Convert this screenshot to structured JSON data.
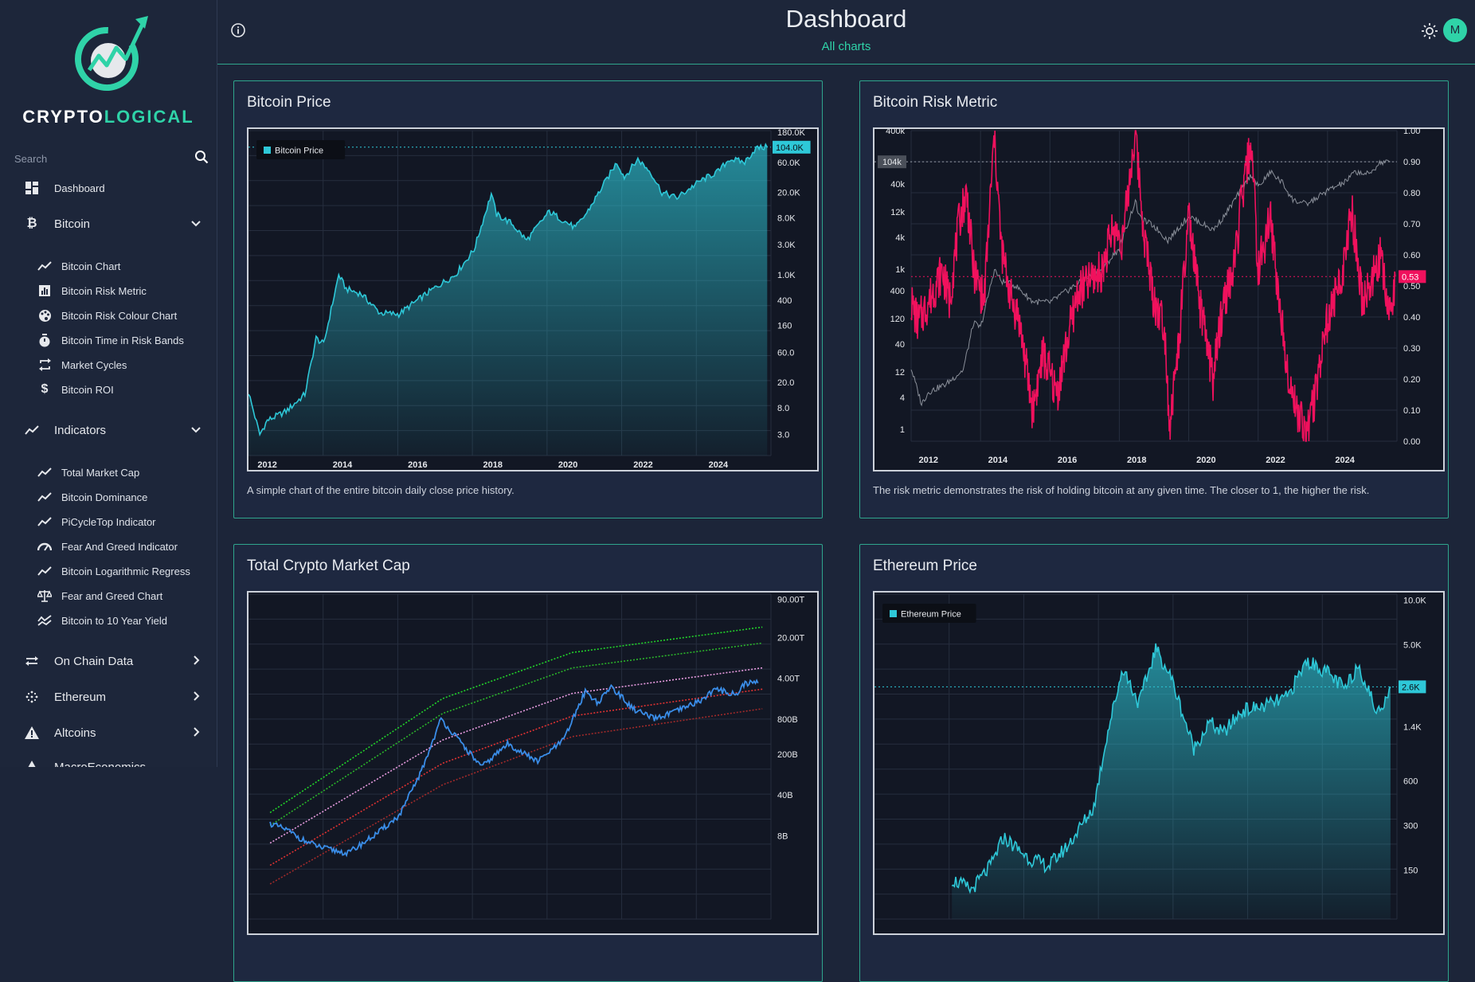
{
  "brand": {
    "name_prefix": "CRYPTO",
    "name_accent": "LOGICAL"
  },
  "search": {
    "placeholder": "Search"
  },
  "sidebar": {
    "dashboard": "Dashboard",
    "bitcoin": {
      "label": "Bitcoin",
      "items": [
        "Bitcoin Chart",
        "Bitcoin Risk Metric",
        "Bitcoin Risk Colour Chart",
        "Bitcoin Time in Risk Bands",
        "Market Cycles",
        "Bitcoin ROI"
      ]
    },
    "indicators": {
      "label": "Indicators",
      "items": [
        "Total Market Cap",
        "Bitcoin Dominance",
        "PiCycleTop Indicator",
        "Fear And Greed Indicator",
        "Bitcoin Logarithmic Regress",
        "Fear and Greed Chart",
        "Bitcoin to 10 Year Yield"
      ]
    },
    "on_chain": "On Chain Data",
    "ethereum": "Ethereum",
    "altcoins": "Altcoins",
    "macro": "MacroEconomics"
  },
  "header": {
    "title": "Dashboard",
    "subtitle": "All charts",
    "avatar_letter": "M"
  },
  "colors": {
    "accent": "#2fd3a8",
    "btc_line": "#2ec8d8",
    "risk_line": "#f0115d",
    "mcap_line": "#3a8de8"
  },
  "cards": {
    "btc_price": {
      "title": "Bitcoin Price",
      "desc": "A simple chart of the entire bitcoin daily close price history."
    },
    "btc_risk": {
      "title": "Bitcoin Risk Metric",
      "desc": "The risk metric demonstrates the risk of holding bitcoin at any given time. The closer to 1, the higher the risk."
    },
    "mcap": {
      "title": "Total Crypto Market Cap"
    },
    "eth_price": {
      "title": "Ethereum Price"
    }
  },
  "chart_data": [
    {
      "type": "area",
      "title": "Bitcoin Price",
      "scale": "log",
      "legend": "Bitcoin Price",
      "legend_position": "top-left",
      "x_ticks": [
        "2012",
        "2014",
        "2016",
        "2018",
        "2020",
        "2022",
        "2024"
      ],
      "y_ticks": [
        "180.0K",
        "60.0K",
        "20.0K",
        "8.0K",
        "3.0K",
        "1.0K",
        "400",
        "160",
        "60.0",
        "20.0",
        "8.0",
        "3.0"
      ],
      "last_value_label": "104.0K",
      "x": [
        2011.5,
        2011.8,
        2012.0,
        2012.5,
        2013.0,
        2013.3,
        2013.5,
        2013.9,
        2014.1,
        2014.5,
        2015.0,
        2015.5,
        2016.0,
        2016.5,
        2017.0,
        2017.5,
        2017.96,
        2018.1,
        2018.5,
        2018.9,
        2019.5,
        2020.2,
        2020.5,
        2021.0,
        2021.3,
        2021.5,
        2021.86,
        2022.2,
        2022.5,
        2022.9,
        2023.5,
        2024.0,
        2024.3,
        2024.7,
        2025.0,
        2025.3
      ],
      "y": [
        14,
        3,
        5,
        7,
        13,
        100,
        80,
        1000,
        600,
        500,
        250,
        240,
        400,
        650,
        1000,
        2500,
        19000,
        9000,
        6500,
        3500,
        10000,
        5500,
        9500,
        30000,
        60000,
        35000,
        67000,
        42000,
        20000,
        16500,
        30000,
        43000,
        68000,
        60000,
        100000,
        104000
      ]
    },
    {
      "type": "line",
      "title": "Bitcoin Risk Metric",
      "x_ticks": [
        "2012",
        "2014",
        "2016",
        "2018",
        "2020",
        "2022",
        "2024"
      ],
      "y_left_ticks": [
        "400k",
        "104k",
        "40k",
        "12k",
        "4k",
        "1k",
        "400",
        "120",
        "40",
        "12",
        "4",
        "1"
      ],
      "y_right_ticks": [
        "1.00",
        "0.90",
        "0.80",
        "0.70",
        "0.60",
        "0.50",
        "0.40",
        "0.30",
        "0.20",
        "0.10",
        "0.00"
      ],
      "price_marker_label": "104k",
      "risk_marker_label": "0.53",
      "risk": [
        [
          2011.5,
          0.45
        ],
        [
          2011.7,
          0.38
        ],
        [
          2012.0,
          0.45
        ],
        [
          2012.4,
          0.55
        ],
        [
          2012.6,
          0.45
        ],
        [
          2012.9,
          0.72
        ],
        [
          2013.1,
          0.8
        ],
        [
          2013.3,
          0.55
        ],
        [
          2013.6,
          0.45
        ],
        [
          2013.9,
          0.99
        ],
        [
          2014.1,
          0.62
        ],
        [
          2014.4,
          0.45
        ],
        [
          2014.6,
          0.4
        ],
        [
          2015.0,
          0.1
        ],
        [
          2015.3,
          0.28
        ],
        [
          2015.7,
          0.15
        ],
        [
          2016.0,
          0.32
        ],
        [
          2016.3,
          0.48
        ],
        [
          2016.7,
          0.52
        ],
        [
          2017.0,
          0.55
        ],
        [
          2017.3,
          0.68
        ],
        [
          2017.6,
          0.65
        ],
        [
          2017.96,
          1.0
        ],
        [
          2018.2,
          0.68
        ],
        [
          2018.5,
          0.45
        ],
        [
          2018.8,
          0.38
        ],
        [
          2018.95,
          0.05
        ],
        [
          2019.2,
          0.3
        ],
        [
          2019.5,
          0.72
        ],
        [
          2019.8,
          0.45
        ],
        [
          2020.2,
          0.2
        ],
        [
          2020.5,
          0.45
        ],
        [
          2020.8,
          0.55
        ],
        [
          2021.0,
          0.75
        ],
        [
          2021.3,
          0.97
        ],
        [
          2021.5,
          0.55
        ],
        [
          2021.86,
          0.72
        ],
        [
          2022.1,
          0.45
        ],
        [
          2022.4,
          0.2
        ],
        [
          2022.6,
          0.1
        ],
        [
          2022.9,
          0.03
        ],
        [
          2023.1,
          0.12
        ],
        [
          2023.4,
          0.35
        ],
        [
          2023.7,
          0.45
        ],
        [
          2024.0,
          0.58
        ],
        [
          2024.2,
          0.75
        ],
        [
          2024.5,
          0.45
        ],
        [
          2024.8,
          0.52
        ],
        [
          2025.0,
          0.6
        ],
        [
          2025.3,
          0.4
        ],
        [
          2025.45,
          0.53
        ]
      ],
      "price": [
        [
          2011.5,
          14
        ],
        [
          2011.8,
          3
        ],
        [
          2012.0,
          5
        ],
        [
          2012.5,
          7
        ],
        [
          2013.0,
          13
        ],
        [
          2013.3,
          100
        ],
        [
          2013.5,
          80
        ],
        [
          2013.9,
          1000
        ],
        [
          2014.1,
          600
        ],
        [
          2014.5,
          500
        ],
        [
          2015.0,
          250
        ],
        [
          2015.5,
          240
        ],
        [
          2016.0,
          400
        ],
        [
          2016.5,
          650
        ],
        [
          2017.0,
          1000
        ],
        [
          2017.5,
          2500
        ],
        [
          2017.96,
          19000
        ],
        [
          2018.1,
          9000
        ],
        [
          2018.5,
          6500
        ],
        [
          2018.9,
          3500
        ],
        [
          2019.5,
          10000
        ],
        [
          2020.2,
          5500
        ],
        [
          2020.5,
          9500
        ],
        [
          2021.0,
          30000
        ],
        [
          2021.3,
          60000
        ],
        [
          2021.5,
          35000
        ],
        [
          2021.86,
          67000
        ],
        [
          2022.2,
          42000
        ],
        [
          2022.5,
          20000
        ],
        [
          2022.9,
          16500
        ],
        [
          2023.5,
          30000
        ],
        [
          2024.0,
          43000
        ],
        [
          2024.3,
          68000
        ],
        [
          2024.7,
          60000
        ],
        [
          2025.0,
          100000
        ],
        [
          2025.3,
          104000
        ]
      ]
    },
    {
      "type": "line",
      "title": "Total Crypto Market Cap",
      "scale": "log",
      "y_ticks": [
        "90.00T",
        "20.00T",
        "4.00T",
        "800B",
        "200B",
        "40B",
        "8B"
      ],
      "x": [
        2014.0,
        2014.4,
        2014.8,
        2015.2,
        2015.8,
        2016.5,
        2017.0,
        2017.5,
        2017.96,
        2018.3,
        2018.9,
        2019.5,
        2020.2,
        2020.8,
        2021.3,
        2021.6,
        2021.9,
        2022.4,
        2022.9,
        2023.5,
        2024.0,
        2024.3,
        2024.8,
        2025.0,
        2025.3
      ],
      "y": [
        13,
        10,
        6.5,
        5,
        4,
        9,
        18,
        100,
        800,
        400,
        120,
        300,
        150,
        350,
        2400,
        1500,
        2900,
        1200,
        800,
        1150,
        1700,
        2600,
        2100,
        3300,
        3300
      ],
      "bands": [
        {
          "color": "#22d42a",
          "style": "dotted",
          "y": [
            [
              2014.0,
              20
            ],
            [
              2018,
              1800
            ],
            [
              2021,
              11000
            ],
            [
              2025.4,
              30000
            ]
          ]
        },
        {
          "color": "#2bb52a",
          "style": "dotted",
          "y": [
            [
              2014.0,
              12
            ],
            [
              2018,
              1000
            ],
            [
              2021,
              6000
            ],
            [
              2025.4,
              16000
            ]
          ]
        },
        {
          "color": "#e89ce0",
          "style": "dotted",
          "y": [
            [
              2014.0,
              6
            ],
            [
              2018,
              350
            ],
            [
              2021,
              2200
            ],
            [
              2025.4,
              6000
            ]
          ]
        },
        {
          "color": "#e03232",
          "style": "dotted",
          "y": [
            [
              2014.0,
              2.5
            ],
            [
              2018,
              140
            ],
            [
              2021,
              900
            ],
            [
              2025.4,
              2600
            ]
          ]
        },
        {
          "color": "#a12a2a",
          "style": "dotted",
          "y": [
            [
              2014.0,
              1.2
            ],
            [
              2018,
              60
            ],
            [
              2021,
              400
            ],
            [
              2025.4,
              1200
            ]
          ]
        }
      ]
    },
    {
      "type": "area",
      "title": "Ethereum Price",
      "scale": "log",
      "legend": "Ethereum Price",
      "legend_position": "top-left",
      "y_ticks": [
        "10.0K",
        "5.0K",
        "1.4K",
        "600",
        "300",
        "150"
      ],
      "last_value_label": "2.6K",
      "x": [
        2018.7,
        2019.0,
        2019.3,
        2019.5,
        2019.9,
        2020.2,
        2020.5,
        2020.9,
        2021.1,
        2021.35,
        2021.6,
        2021.86,
        2022.1,
        2022.45,
        2022.7,
        2022.9,
        2023.2,
        2023.5,
        2023.9,
        2024.2,
        2024.5,
        2024.8,
        2025.0,
        2025.3,
        2025.5
      ],
      "y": [
        130,
        110,
        160,
        250,
        180,
        160,
        220,
        400,
        1200,
        3500,
        2000,
        4700,
        3000,
        1000,
        1500,
        1250,
        1800,
        1900,
        2200,
        3900,
        3300,
        2500,
        3700,
        1700,
        2600
      ]
    }
  ]
}
